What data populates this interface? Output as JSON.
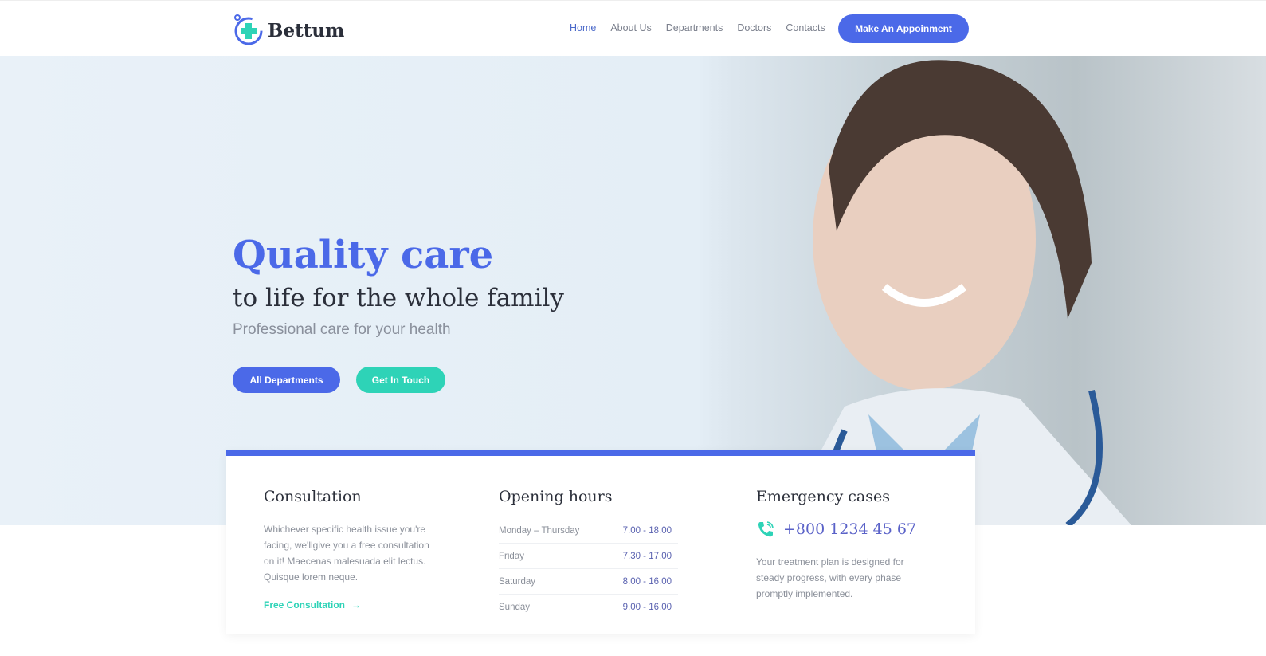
{
  "header": {
    "brand": "Bettum",
    "nav": [
      "Home",
      "About Us",
      "Departments",
      "Doctors",
      "Contacts"
    ],
    "active": "Home",
    "cta": "Make An Appoinment"
  },
  "hero": {
    "title": "Quality care",
    "subtitle": "to life for the whole family",
    "tagline": "Professional care for your health",
    "buttons": [
      "All Departments",
      "Get In Touch"
    ]
  },
  "colors": {
    "primary": "#4b69e8",
    "secondary": "#2ed3b7"
  },
  "consultation": {
    "title": "Consultation",
    "text": "Whichever specific health issue you're facing, we'llgive you a free consultation on it! Maecenas malesuada elit lectus. Quisque lorem neque.",
    "link": "Free Consultation"
  },
  "hours": {
    "title": "Opening hours",
    "rows": [
      {
        "day": "Monday – Thursday",
        "time": "7.00 - 18.00"
      },
      {
        "day": "Friday",
        "time": "7.30 - 17.00"
      },
      {
        "day": "Saturday",
        "time": "8.00 - 16.00"
      },
      {
        "day": "Sunday",
        "time": "9.00 - 16.00"
      }
    ]
  },
  "emergency": {
    "title": "Emergency cases",
    "phone": "+800 1234 45 67",
    "text": "Your treatment plan is designed for steady progress, with every phase promptly implemented."
  }
}
